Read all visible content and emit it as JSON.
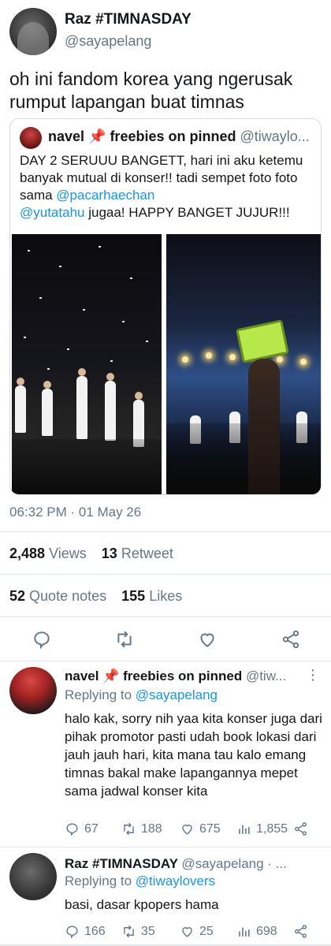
{
  "main_tweet": {
    "author_name": "Raz #TIMNASDAY",
    "author_handle": "@sayapelang",
    "text": "oh ini fandom korea yang ngerusak rumput lapangan buat timnas",
    "quote": {
      "author_name": "navel 📌 freebies on pinned",
      "author_handle": "@tiwaylo...",
      "text_before": "DAY 2 SERUUU BANGETT, hari ini aku ketemu banyak mutual di konser!! tadi sempet foto foto sama ",
      "mention1": "@pacarhaechan",
      "mention2": "@yutatahu",
      "text_after": " jugaa! HAPPY BANGET JUJUR!!!"
    },
    "timestamp": "06:32 PM · 01 May 26",
    "views_count": "2,488",
    "views_label": "Views",
    "retweets_count": "13",
    "retweets_label": "Retweet",
    "quotes_count": "52",
    "quotes_label": "Quote notes",
    "likes_count": "155",
    "likes_label": "Likes",
    "action_icons": [
      "reply-icon",
      "retweet-icon",
      "like-icon",
      "share-icon"
    ]
  },
  "replies": [
    {
      "author_name": "navel 📌 freebies on pinned",
      "author_handle": "@tiw...",
      "replying_prefix": "Replying to",
      "replying_to": "@sayapelang",
      "text": "halo kak, sorry nih yaa kita konser juga dari pihak promotor pasti udah book lokasi dari jauh jauh hari, kita mana tau kalo emang timnas bakal make lapangannya mepet sama jadwal konser kita",
      "replies": "67",
      "retweets": "188",
      "likes": "675",
      "views": "1,855"
    },
    {
      "author_name": "Raz #TIMNASDAY",
      "author_handle": "@sayapelang · ...",
      "replying_prefix": "Replying to",
      "replying_to": "@tiwaylovers",
      "text": "basi, dasar kpopers hama",
      "replies": "166",
      "retweets": "35",
      "likes": "25",
      "views": "698"
    }
  ],
  "colors": {
    "link": "#1b95e0",
    "muted": "#657786",
    "divider": "#e1e8ed"
  }
}
